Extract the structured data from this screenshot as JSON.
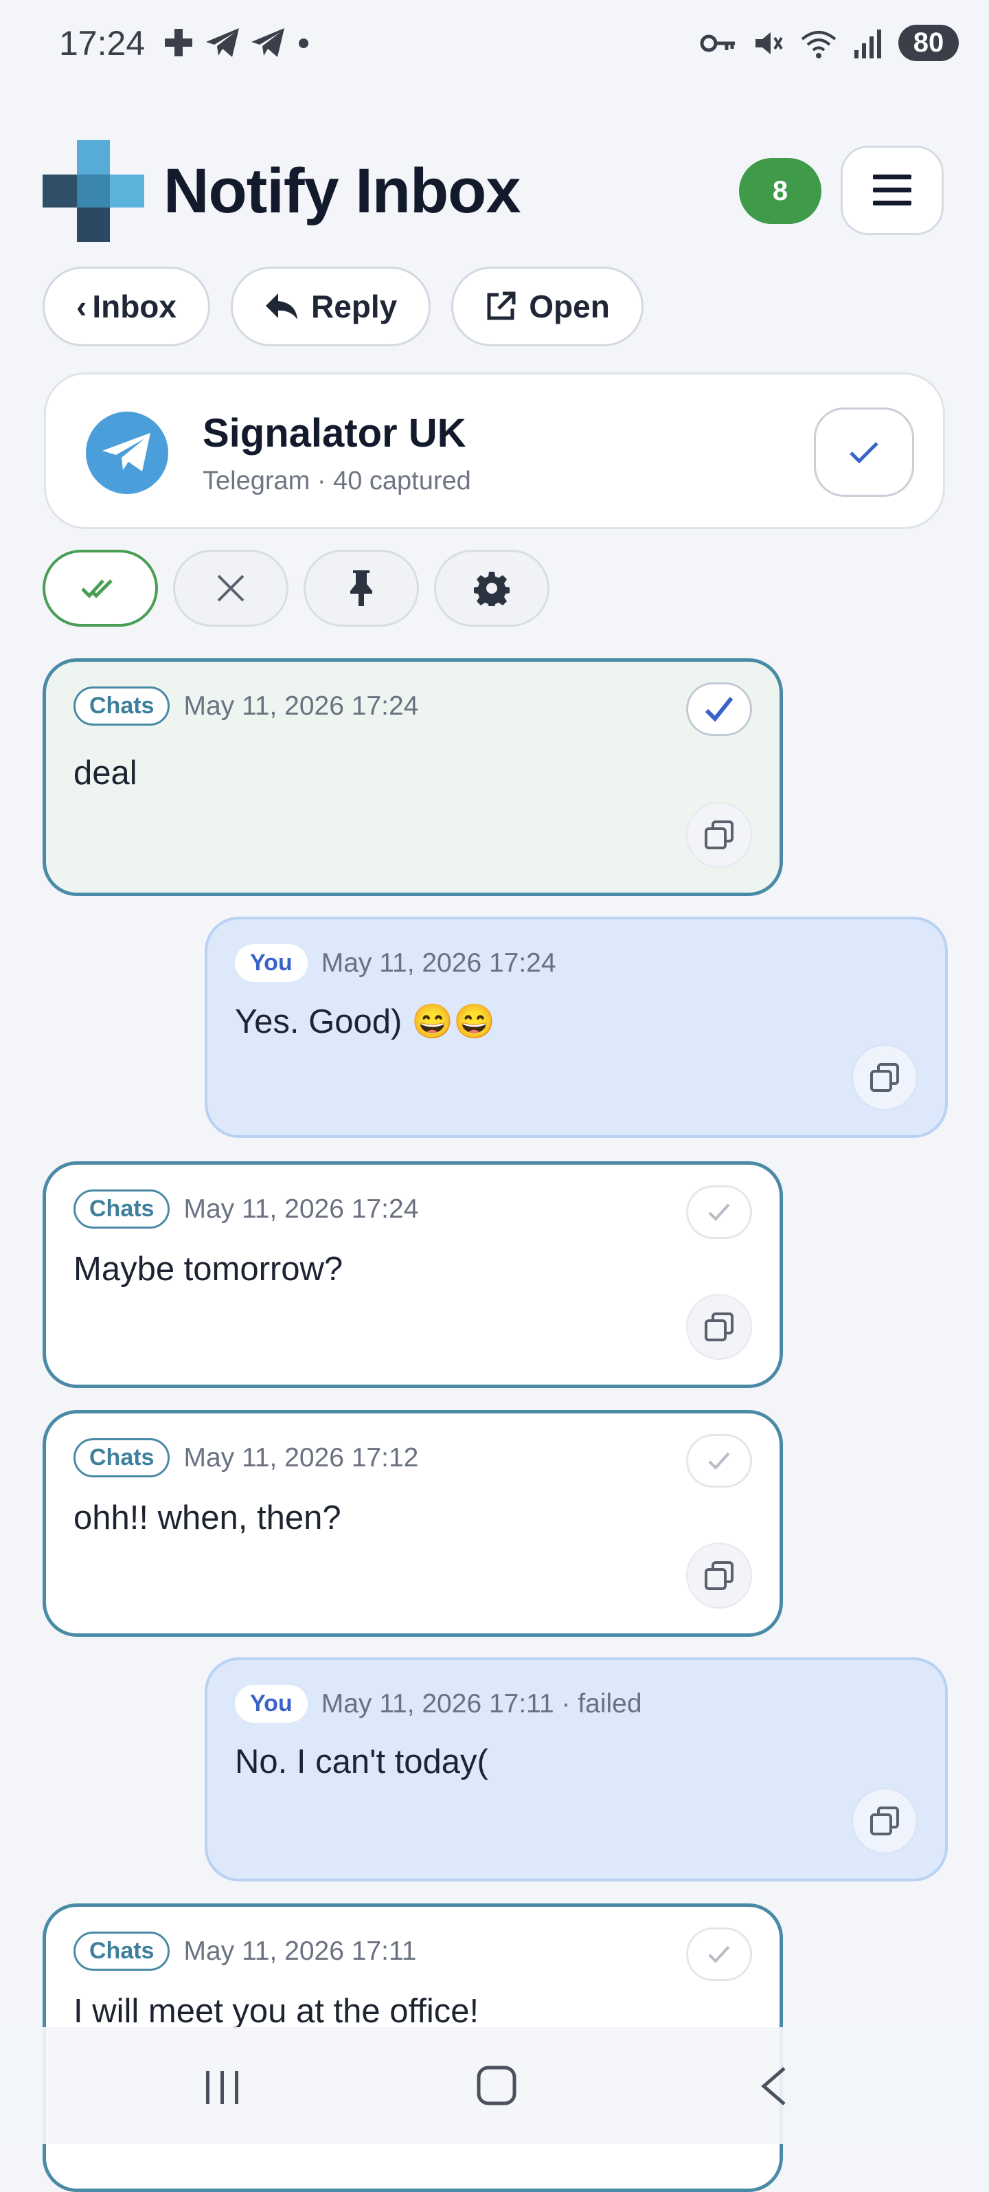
{
  "status_bar": {
    "time": "17:24",
    "battery": "80",
    "left_icons": [
      "plus-icon",
      "telegram-icon",
      "telegram-icon",
      "dot-icon"
    ],
    "right_icons": [
      "key-icon",
      "mute-icon",
      "wifi-icon",
      "signal-icon"
    ]
  },
  "header": {
    "title": "Notify Inbox",
    "badge_count": "8",
    "menu_icon": "hamburger-icon"
  },
  "actions": {
    "inbox_label": "Inbox",
    "reply_label": "Reply",
    "open_label": "Open"
  },
  "contact": {
    "name": "Signalator UK",
    "subtitle": "Telegram · 40 captured"
  },
  "filters": [
    "double-check-icon",
    "close-icon",
    "pin-icon",
    "gear-icon"
  ],
  "messages": [
    {
      "direction": "in",
      "tag": "Chats",
      "time": "May 11, 2026 17:24",
      "text": "deal",
      "checked": true
    },
    {
      "direction": "out",
      "tag": "You",
      "time": "May 11, 2026 17:24",
      "text": "Yes. Good) 😄😄"
    },
    {
      "direction": "in",
      "tag": "Chats",
      "time": "May 11, 2026 17:24",
      "text": "Maybe tomorrow?",
      "checked": false
    },
    {
      "direction": "in",
      "tag": "Chats",
      "time": "May 11, 2026 17:12",
      "text": "ohh!! when, then?",
      "checked": false
    },
    {
      "direction": "out",
      "tag": "You",
      "time": "May 11, 2026 17:11 · failed",
      "text": "No. I can't today("
    },
    {
      "direction": "in",
      "tag": "Chats",
      "time": "May 11, 2026 17:11",
      "text": "I will meet you at the office!",
      "checked": false
    }
  ],
  "colors": {
    "accent_teal": "#4a8aa6",
    "badge_green": "#3f9a4a",
    "outgoing_bg": "#dde8fa",
    "check_blue": "#3a63c9"
  }
}
